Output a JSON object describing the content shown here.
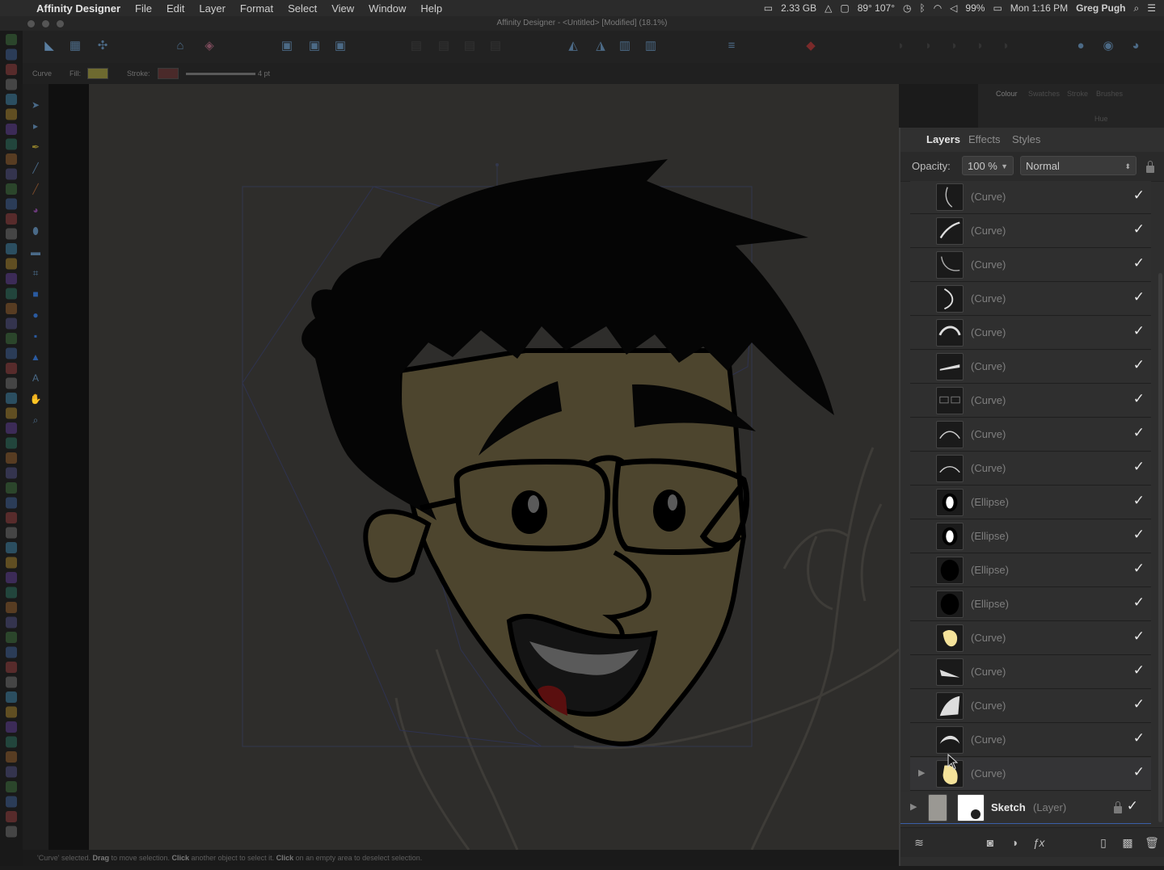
{
  "menubar": {
    "app_name": "Affinity Designer",
    "menus": [
      "File",
      "Edit",
      "Layer",
      "Format",
      "Select",
      "View",
      "Window",
      "Help"
    ],
    "status": {
      "memory": "2.33 GB",
      "temperature": "89° 107°",
      "battery": "99%",
      "clock": "Mon 1:16 PM",
      "user": "Greg Pugh"
    }
  },
  "window": {
    "title": "Affinity Designer - <Untitled> [Modified] (18.1%)"
  },
  "context": {
    "tool": "Curve",
    "fill_label": "Fill:",
    "fill_color": "#6e6a30",
    "stroke_label": "Stroke:",
    "stroke_width": "4 pt"
  },
  "colour_panel": {
    "tabs": [
      "Colour",
      "Swatches",
      "Stroke",
      "Brushes"
    ],
    "mode": "Hue"
  },
  "layers_panel": {
    "tabs": [
      "Layers",
      "Effects",
      "Styles"
    ],
    "active_tab": "Layers",
    "opacity_label": "Opacity:",
    "opacity_value": "100 %",
    "blend_mode": "Normal",
    "items": [
      {
        "name": "(Curve)",
        "thumb": "curve-line-1",
        "checked": "✓"
      },
      {
        "name": "(Curve)",
        "thumb": "curve-line-2",
        "checked": "✓"
      },
      {
        "name": "(Curve)",
        "thumb": "curve-line-3",
        "checked": "✓"
      },
      {
        "name": "(Curve)",
        "thumb": "curve-line-4",
        "checked": "✓"
      },
      {
        "name": "(Curve)",
        "thumb": "curve-eyebrow",
        "checked": "✓"
      },
      {
        "name": "(Curve)",
        "thumb": "curve-eyebrow-2",
        "checked": "✓"
      },
      {
        "name": "(Curve)",
        "thumb": "curve-glasses",
        "checked": "✓"
      },
      {
        "name": "(Curve)",
        "thumb": "curve-arc",
        "checked": "✓"
      },
      {
        "name": "(Curve)",
        "thumb": "curve-arc-2",
        "checked": "✓"
      },
      {
        "name": "(Ellipse)",
        "thumb": "ellipse-white",
        "checked": "✓"
      },
      {
        "name": "(Ellipse)",
        "thumb": "ellipse-white",
        "checked": "✓"
      },
      {
        "name": "(Ellipse)",
        "thumb": "ellipse-black",
        "checked": "✓"
      },
      {
        "name": "(Ellipse)",
        "thumb": "ellipse-black",
        "checked": "✓"
      },
      {
        "name": "(Curve)",
        "thumb": "curve-ear-fill",
        "checked": "✓"
      },
      {
        "name": "(Curve)",
        "thumb": "curve-mouth",
        "checked": "✓"
      },
      {
        "name": "(Curve)",
        "thumb": "curve-hair-spike",
        "checked": "✓"
      },
      {
        "name": "(Curve)",
        "thumb": "curve-hair",
        "checked": "✓"
      },
      {
        "name": "(Curve)",
        "thumb": "curve-face-fill",
        "checked": "✓",
        "expandable": true,
        "selected": true
      }
    ],
    "sketch_layer": {
      "name": "Sketch",
      "kind": "(Layer)",
      "checked": "✓"
    }
  },
  "status_bar": {
    "text_1": "'Curve' selected. ",
    "drag": "Drag",
    "text_2": " to move selection. ",
    "click_1": "Click",
    "text_3": " another object to select it. ",
    "click_2": "Click",
    "text_4": " on an empty area to deselect selection."
  }
}
